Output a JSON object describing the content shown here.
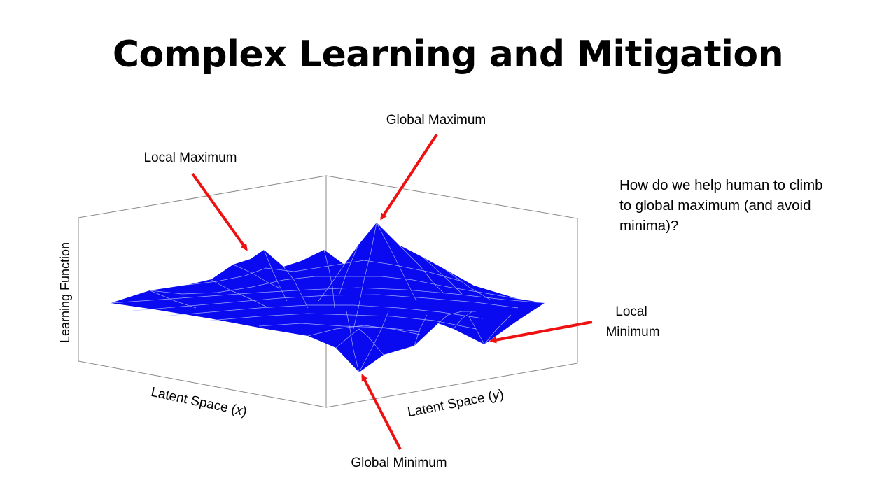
{
  "slide": {
    "title": "Complex Learning and Mitigation"
  },
  "question": {
    "lines": [
      "How do we help human to climb",
      "to global maximum (and avoid",
      "minima)?"
    ]
  },
  "surface_plot": {
    "type": "3d-surface",
    "axes": {
      "x_label": "Latent Space (",
      "x_var": "x",
      "x_close": ")",
      "y_label": "Latent Space (",
      "y_var": "y",
      "y_close": ")",
      "z_label": "Learning Function"
    },
    "surface_color": "#0a0af0",
    "mesh_color": "#b9c4ff",
    "annotations": {
      "local_maximum": "Local Maximum",
      "global_maximum": "Global Maximum",
      "local_minimum_line1": "Local",
      "local_minimum_line2": "Minimum",
      "global_minimum": "Global Minimum"
    },
    "arrow_color": "#ee1111"
  }
}
